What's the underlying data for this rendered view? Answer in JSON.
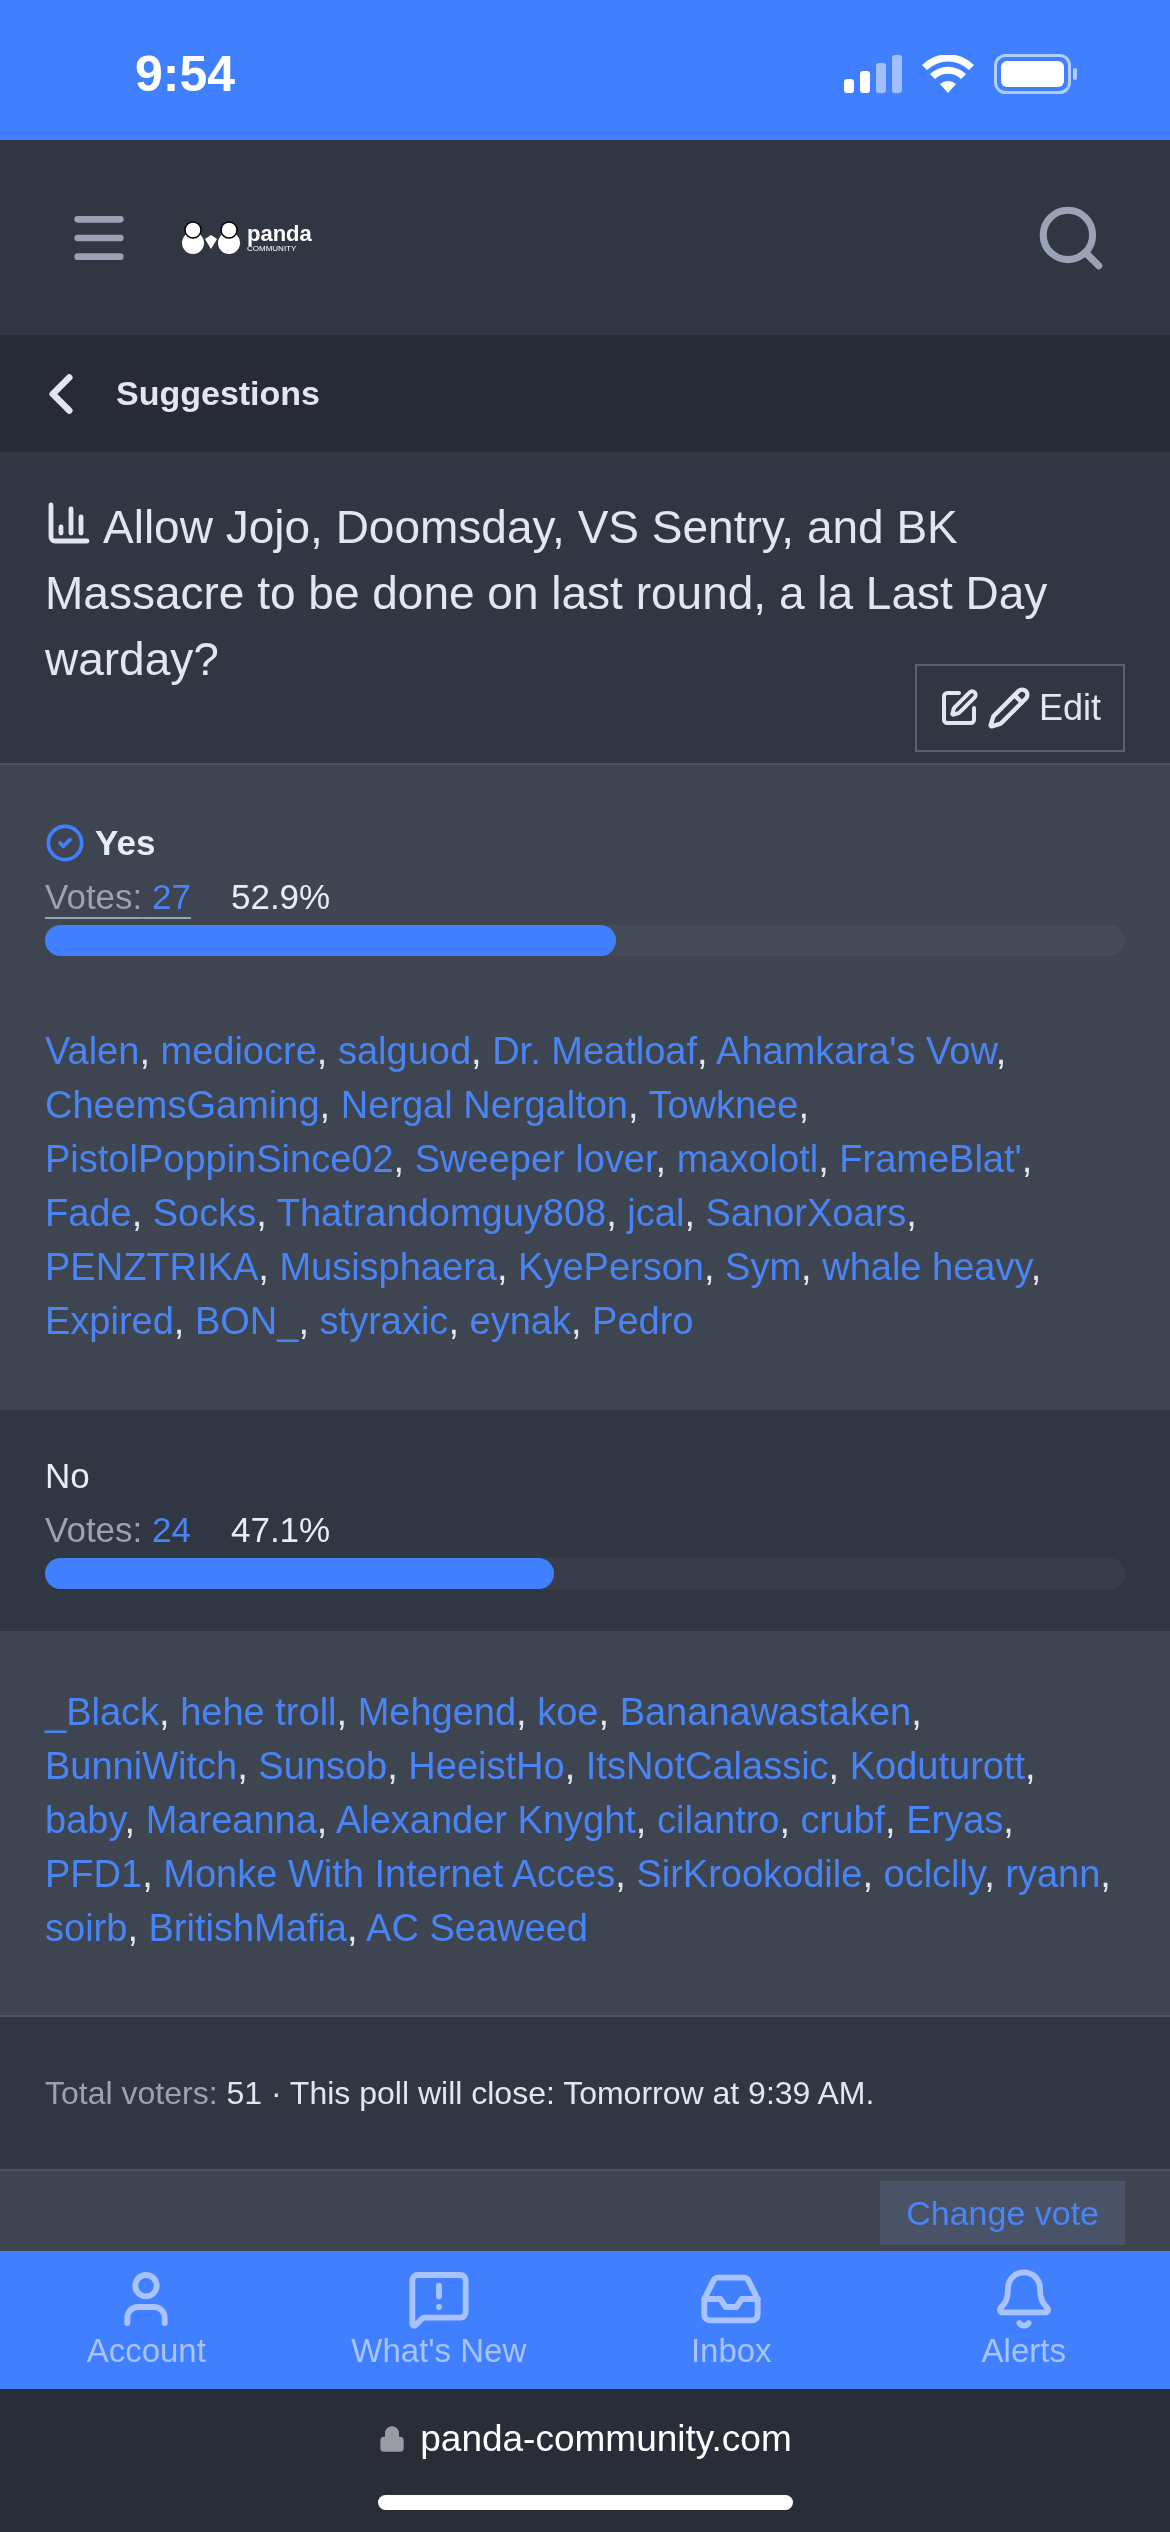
{
  "status_bar": {
    "time": "9:54"
  },
  "header": {
    "logo": {
      "word": "panda",
      "sub": "COMMUNITY"
    }
  },
  "breadcrumb": {
    "label": "Suggestions"
  },
  "poll": {
    "question": "Allow Jojo, Doomsday, VS Sentry, and BK Massacre to be done on last round, a la Last Day warday?",
    "edit_label": "Edit",
    "separator": ",",
    "options": [
      {
        "label": "Yes",
        "voted": true,
        "votes_label": "Votes:",
        "votes": "27",
        "underlined": true,
        "percent": "52.9%",
        "level": 0.529,
        "voters": [
          "Valen",
          "mediocre",
          "salguod",
          "Dr. Meatloaf",
          "Ahamkara's Vow",
          "CheemsGaming",
          "Nergal Nergalton",
          "Towknee",
          "PistolPoppinSince02",
          "Sweeper lover",
          "maxolotl",
          "FrameBlat'",
          "Fade",
          "Socks",
          "Thatrandomguy808",
          "jcal",
          "SanorXoars",
          "PENZTRIKA",
          "Musisphaera",
          "KyePerson",
          "Sym",
          "whale heavy",
          "Expired",
          "BON_",
          "styraxic",
          "eynak",
          "Pedro"
        ]
      },
      {
        "label": "No",
        "voted": false,
        "votes_label": "Votes:",
        "votes": "24",
        "underlined": false,
        "percent": "47.1%",
        "level": 0.471,
        "voters": [
          "_Black",
          "hehe troll",
          "Mehgend",
          "koe",
          "Bananawastaken",
          "BunniWitch",
          "Sunsob",
          "HeeistHo",
          "ItsNotCalassic",
          "Koduturott",
          "baby",
          "Mareanna",
          "Alexander Knyght",
          "cilantro",
          "crubf",
          "Eryas",
          "PFD1",
          "Monke With Internet Acces",
          "SirKrookodile",
          "oclclly",
          "ryann",
          "soirb",
          "BritishMafia",
          "AC Seaweed"
        ]
      }
    ],
    "total_label": "Total voters:",
    "total": "51",
    "close_text": "· This poll will close: Tomorrow at 9:39 AM.",
    "change_vote": "Change vote"
  },
  "tab_bar": [
    {
      "kind": "account",
      "label": "Account"
    },
    {
      "kind": "new",
      "label": "What's New"
    },
    {
      "kind": "inbox",
      "label": "Inbox"
    },
    {
      "kind": "alerts",
      "label": "Alerts"
    }
  ],
  "browser": {
    "url": "panda-community.com"
  }
}
